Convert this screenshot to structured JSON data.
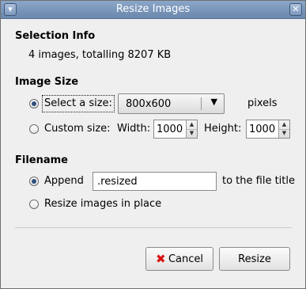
{
  "window": {
    "title": "Resize Images",
    "menu_icon": "window-menu-icon",
    "close_icon": "close-icon"
  },
  "selection": {
    "heading": "Selection Info",
    "info": "4 images, totalling 8207 KB"
  },
  "image_size": {
    "heading": "Image Size",
    "select_label": "Select a size:",
    "selected_size": "800x600",
    "units": "pixels",
    "custom_label": "Custom size:",
    "width_label": "Width:",
    "width_value": "1000",
    "height_label": "Height:",
    "height_value": "1000"
  },
  "filename": {
    "heading": "Filename",
    "append_label": "Append",
    "append_value": ".resized",
    "append_suffix": "to the file title",
    "inplace_label": "Resize images in place"
  },
  "buttons": {
    "cancel": "Cancel",
    "resize": "Resize"
  },
  "colors": {
    "titlebar": "#7896bb",
    "cancel_icon": "#dd1111"
  }
}
